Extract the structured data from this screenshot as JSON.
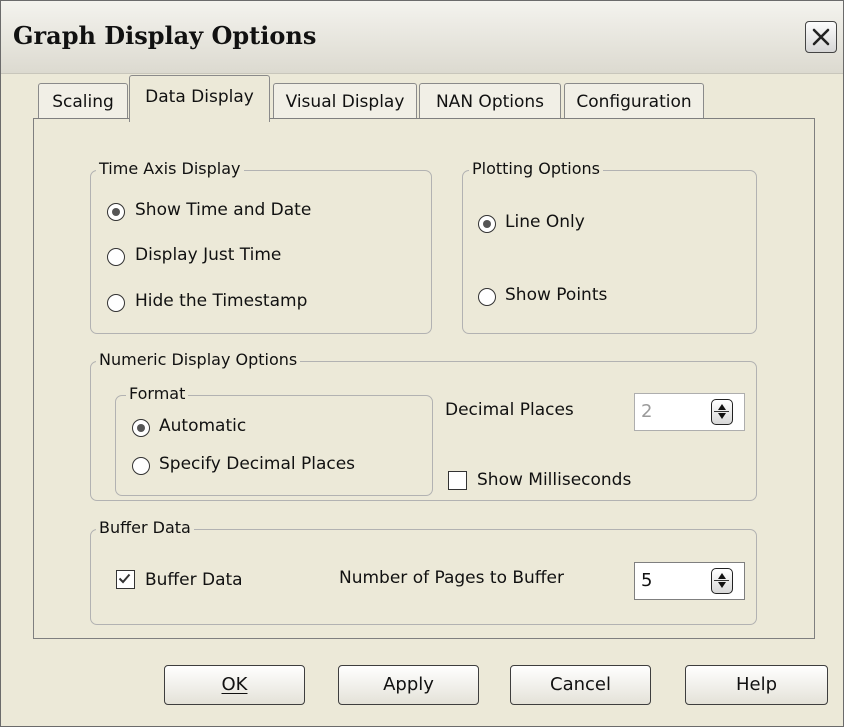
{
  "window": {
    "title": "Graph Display Options"
  },
  "tabs": [
    {
      "label": "Scaling"
    },
    {
      "label": "Data Display"
    },
    {
      "label": "Visual Display"
    },
    {
      "label": "NAN Options"
    },
    {
      "label": "Configuration"
    }
  ],
  "active_tab": "Data Display",
  "time_axis": {
    "legend": "Time Axis Display",
    "options": [
      {
        "label": "Show Time and Date",
        "selected": true
      },
      {
        "label": "Display Just Time",
        "selected": false
      },
      {
        "label": "Hide the Timestamp",
        "selected": false
      }
    ]
  },
  "plotting": {
    "legend": "Plotting Options",
    "options": [
      {
        "label": "Line Only",
        "selected": true
      },
      {
        "label": "Show Points",
        "selected": false
      }
    ]
  },
  "numeric": {
    "legend": "Numeric Display Options",
    "format": {
      "legend": "Format",
      "options": [
        {
          "label": "Automatic",
          "selected": true
        },
        {
          "label": "Specify Decimal Places",
          "selected": false
        }
      ]
    },
    "decimal_places_label": "Decimal Places",
    "decimal_places_value": "2",
    "show_ms_label": "Show Milliseconds",
    "show_ms_checked": false
  },
  "buffer": {
    "legend": "Buffer Data",
    "checkbox_label": "Buffer Data",
    "checked": true,
    "pages_label": "Number of Pages to Buffer",
    "pages_value": "5"
  },
  "buttons": {
    "ok": "OK",
    "apply": "Apply",
    "cancel": "Cancel",
    "help": "Help"
  },
  "icons": {
    "close": "close-icon",
    "spin": "spin-arrows-icon",
    "check": "checkmark-icon"
  }
}
